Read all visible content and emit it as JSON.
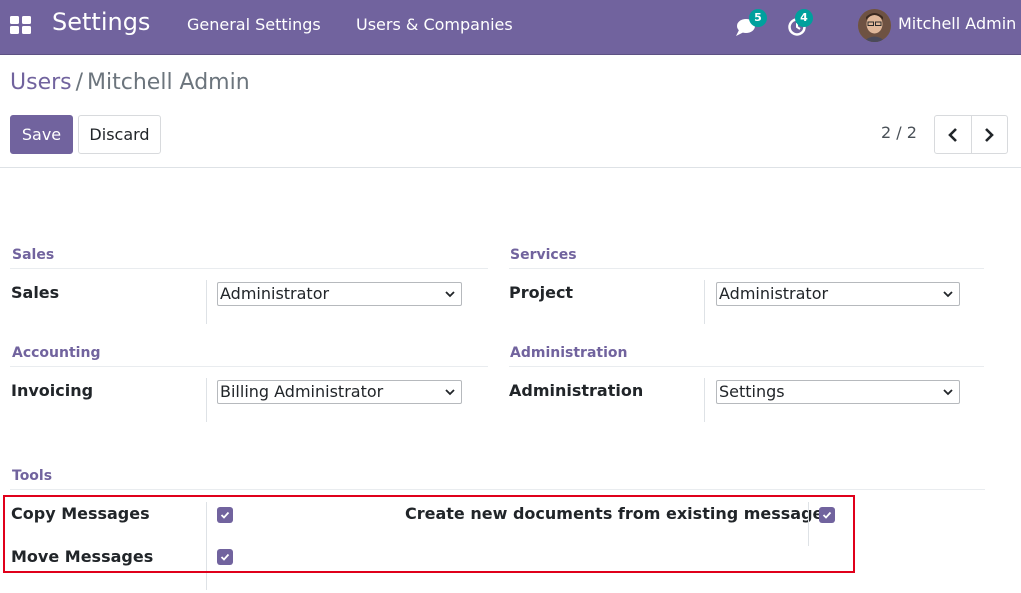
{
  "navbar": {
    "app_name": "Settings",
    "menus": [
      "General Settings",
      "Users & Companies"
    ],
    "messages_count": "5",
    "activities_count": "4",
    "user_name": "Mitchell Admin"
  },
  "breadcrumb": {
    "parent": "Users",
    "separator": "/",
    "current": "Mitchell Admin"
  },
  "buttons": {
    "save": "Save",
    "discard": "Discard"
  },
  "pager": {
    "value": "2 / 2"
  },
  "groups": {
    "sales": {
      "title": "Sales",
      "field_label": "Sales",
      "value": "Administrator"
    },
    "services": {
      "title": "Services",
      "field_label": "Project",
      "value": "Administrator"
    },
    "accounting": {
      "title": "Accounting",
      "field_label": "Invoicing",
      "value": "Billing Administrator"
    },
    "administration": {
      "title": "Administration",
      "field_label": "Administration",
      "value": "Settings"
    },
    "tools": {
      "title": "Tools",
      "copy_messages": "Copy Messages",
      "move_messages": "Move Messages",
      "create_documents": "Create new documents from existing messages"
    }
  },
  "colors": {
    "brand": "#71639e",
    "badge": "#00a09d",
    "highlight": "#e0001b"
  },
  "icons": {
    "apps": "apps-grid-icon",
    "messages": "chat-icon",
    "activities": "clock-icon",
    "pager_prev": "chevron-left-icon",
    "pager_next": "chevron-right-icon",
    "select_caret": "chevron-down-icon",
    "checkbox": "checkmark-icon"
  }
}
